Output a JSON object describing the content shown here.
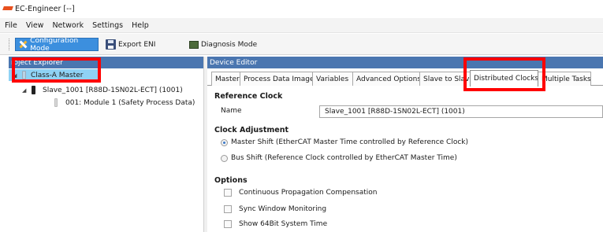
{
  "window": {
    "title": "EC-Engineer [--]"
  },
  "menu": [
    "File",
    "View",
    "Network",
    "Settings",
    "Help"
  ],
  "toolbar": {
    "configuration_mode": "Configuration Mode",
    "export_eni": "Export ENI",
    "diagnosis_mode": "Diagnosis Mode"
  },
  "project_explorer": {
    "header": "roject Explorer",
    "master": "Class-A Master",
    "slave": "Slave_1001 [R88D-1SN02L-ECT] (1001)",
    "module": "001: Module 1 (Safety Process Data)"
  },
  "device_editor": {
    "header": "Device Editor",
    "tabs": [
      "Master",
      "Process Data Image",
      "Variables",
      "Advanced Options",
      "Slave to Slav",
      "Distributed Clocks",
      "Multiple Tasks"
    ],
    "active_tab": "Distributed Clocks",
    "reference_clock": {
      "title": "Reference Clock",
      "name_label": "Name",
      "name_value": "Slave_1001 [R88D-1SN02L-ECT] (1001)"
    },
    "clock_adjustment": {
      "title": "Clock Adjustment",
      "master_shift": "Master Shift (EtherCAT Master Time controlled by Reference Clock)",
      "bus_shift": "Bus Shift (Reference Clock controlled by EtherCAT Master Time)",
      "selected": "Master Shift"
    },
    "options": {
      "title": "Options",
      "continuous": "Continuous Propagation Compensation",
      "sync_window": "Sync Window Monitoring",
      "show_64bit": "Show 64Bit System Time"
    }
  },
  "colors": {
    "pane_header": "#4a76b0",
    "selection": "#8fd2f5",
    "active_button": "#3c8fde",
    "annotation": "#ff0000"
  }
}
